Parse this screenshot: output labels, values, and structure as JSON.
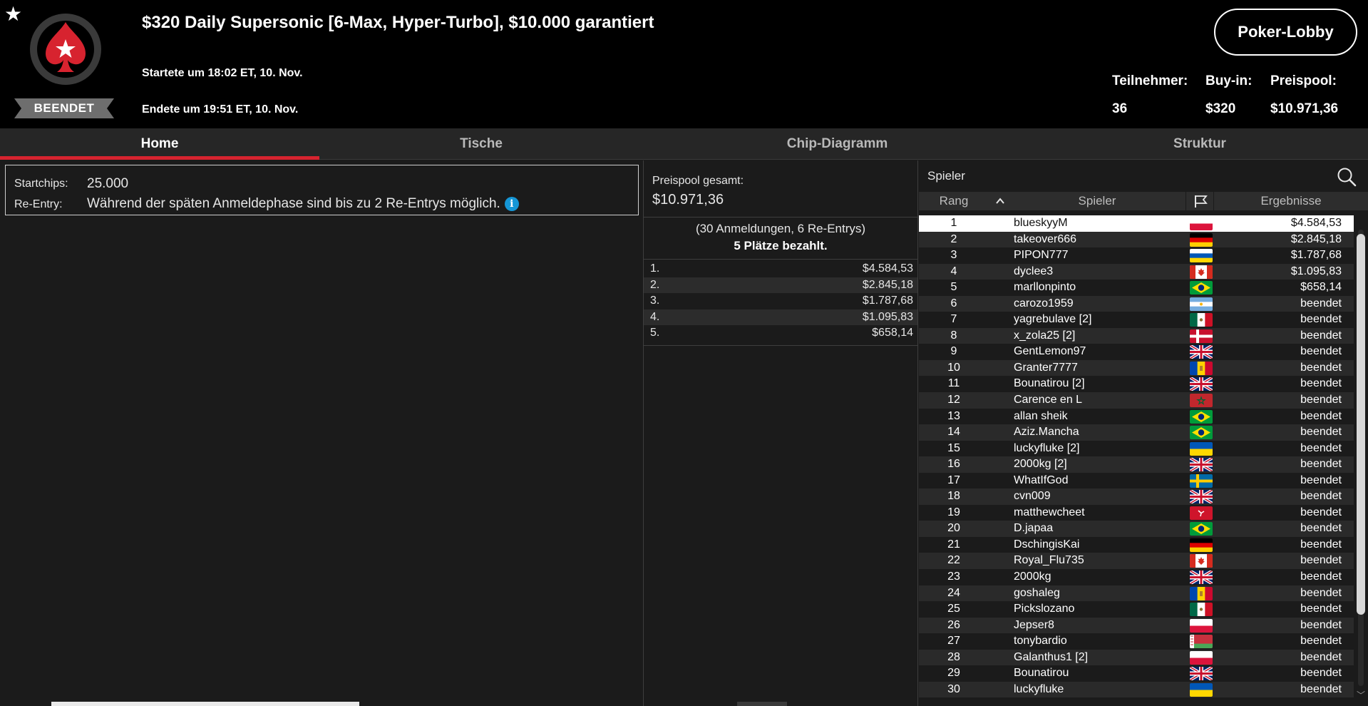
{
  "header": {
    "title": "$320 Daily Supersonic [6-Max, Hyper-Turbo], $10.000 garantiert",
    "started": "Startete um 18:02 ET, 10. Nov.",
    "ended": "Endete um 19:51 ET, 10. Nov.",
    "status": "BEENDET",
    "favorite_icon": "star-icon",
    "lobby_button": "Poker-Lobby",
    "stats": {
      "entrants_label": "Teilnehmer:",
      "entrants_value": "36",
      "buyin_label": "Buy-in:",
      "buyin_value": "$320",
      "prizepool_label": "Preispool:",
      "prizepool_value": "$10.971,36"
    },
    "colors": {
      "brand_red": "#d7232f",
      "logo_ring": "#3a3a3a",
      "info_blue": "#1596d6"
    }
  },
  "tabs": [
    {
      "label": "Home",
      "active": true
    },
    {
      "label": "Tische",
      "active": false
    },
    {
      "label": "Chip-Diagramm",
      "active": false
    },
    {
      "label": "Struktur",
      "active": false
    }
  ],
  "info": {
    "startchips_label": "Startchips:",
    "startchips_value": "25.000",
    "reentry_label": "Re-Entry:",
    "reentry_value": "Während der späten Anmeldephase sind bis zu 2 Re-Entrys möglich.",
    "info_icon": "i"
  },
  "prizepool": {
    "label": "Preispool gesamt:",
    "value": "$10.971,36",
    "entries_text": "(30 Anmeldungen, 6 Re-Entrys)",
    "paid_text": "5 Plätze bezahlt.",
    "payouts": [
      {
        "place": "1.",
        "amount": "$4.584,53"
      },
      {
        "place": "2.",
        "amount": "$2.845,18"
      },
      {
        "place": "3.",
        "amount": "$1.787,68"
      },
      {
        "place": "4.",
        "amount": "$1.095,83"
      },
      {
        "place": "5.",
        "amount": "$658,14"
      }
    ]
  },
  "players": {
    "search_label": "Spieler",
    "columns": {
      "rank": "Rang",
      "player": "Spieler",
      "result": "Ergebnisse"
    },
    "sort_icon": "chevron-up-icon",
    "flag_column_icon": "flag-icon",
    "rows": [
      {
        "rank": "1",
        "name": "blueskyyM",
        "flag": "pl",
        "result": "$4.584,53"
      },
      {
        "rank": "2",
        "name": "takeover666",
        "flag": "de",
        "result": "$2.845,18"
      },
      {
        "rank": "3",
        "name": "PIPON777",
        "flag": "ua-ish",
        "result": "$1.787,68"
      },
      {
        "rank": "4",
        "name": "dyclee3",
        "flag": "ca",
        "result": "$1.095,83"
      },
      {
        "rank": "5",
        "name": "marllonpinto",
        "flag": "br",
        "result": "$658,14"
      },
      {
        "rank": "6",
        "name": "carozo1959",
        "flag": "ar",
        "result": "beendet"
      },
      {
        "rank": "7",
        "name": "yagrebulave [2]",
        "flag": "mx",
        "result": "beendet"
      },
      {
        "rank": "8",
        "name": "x_zola25 [2]",
        "flag": "dk",
        "result": "beendet"
      },
      {
        "rank": "9",
        "name": "GentLemon97",
        "flag": "gb",
        "result": "beendet"
      },
      {
        "rank": "10",
        "name": "Granter7777",
        "flag": "md",
        "result": "beendet"
      },
      {
        "rank": "11",
        "name": "Bounatirou [2]",
        "flag": "gb",
        "result": "beendet"
      },
      {
        "rank": "12",
        "name": "Carence en L",
        "flag": "ma",
        "result": "beendet"
      },
      {
        "rank": "13",
        "name": "allan sheik",
        "flag": "br",
        "result": "beendet"
      },
      {
        "rank": "14",
        "name": "Aziz.Mancha",
        "flag": "br",
        "result": "beendet"
      },
      {
        "rank": "15",
        "name": "luckyfluke [2]",
        "flag": "ua",
        "result": "beendet"
      },
      {
        "rank": "16",
        "name": "2000kg [2]",
        "flag": "gb",
        "result": "beendet"
      },
      {
        "rank": "17",
        "name": "WhatIfGod",
        "flag": "se",
        "result": "beendet"
      },
      {
        "rank": "18",
        "name": "cvn009",
        "flag": "gb",
        "result": "beendet"
      },
      {
        "rank": "19",
        "name": "matthewcheet",
        "flag": "im",
        "result": "beendet"
      },
      {
        "rank": "20",
        "name": "D.japaa",
        "flag": "br",
        "result": "beendet"
      },
      {
        "rank": "21",
        "name": "DschingisKai",
        "flag": "de",
        "result": "beendet"
      },
      {
        "rank": "22",
        "name": "Royal_Flu735",
        "flag": "ca",
        "result": "beendet"
      },
      {
        "rank": "23",
        "name": "2000kg",
        "flag": "gb",
        "result": "beendet"
      },
      {
        "rank": "24",
        "name": "goshaleg",
        "flag": "md",
        "result": "beendet"
      },
      {
        "rank": "25",
        "name": "Pickslozano",
        "flag": "mx",
        "result": "beendet"
      },
      {
        "rank": "26",
        "name": "Jepser8",
        "flag": "pl",
        "result": "beendet"
      },
      {
        "rank": "27",
        "name": "tonybardio",
        "flag": "by",
        "result": "beendet"
      },
      {
        "rank": "28",
        "name": "Galanthus1 [2]",
        "flag": "pl2",
        "result": "beendet"
      },
      {
        "rank": "29",
        "name": "Bounatirou",
        "flag": "gb",
        "result": "beendet"
      },
      {
        "rank": "30",
        "name": "luckyfluke",
        "flag": "ua",
        "result": "beendet"
      }
    ]
  }
}
